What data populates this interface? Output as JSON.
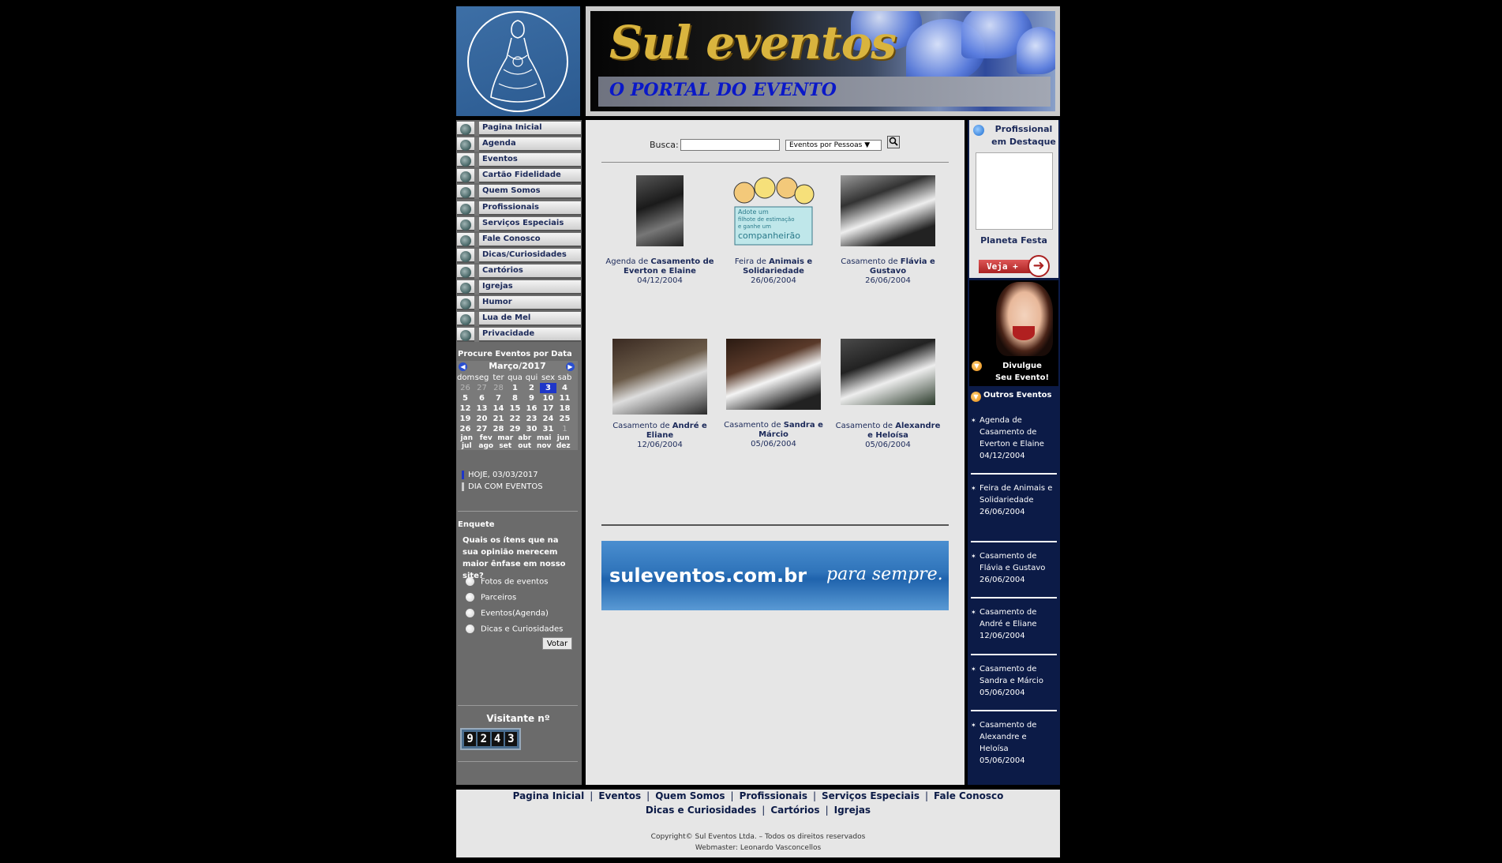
{
  "header": {
    "title": "Sul eventos",
    "subtitle": "O PORTAL DO EVENTO"
  },
  "menu": [
    "Pagina Inicial",
    "Agenda",
    "Eventos",
    "Cartão Fidelidade",
    "Quem Somos",
    "Profissionais",
    "Serviços Especiais",
    "Fale Conosco",
    "Dicas/Curiosidades",
    "Cartórios",
    "Igrejas",
    "Humor",
    "Lua de Mel",
    "Privacidade"
  ],
  "calendar": {
    "heading": "Procure Eventos por Data",
    "month": "Março/2017",
    "prev": "◀",
    "next": "▶",
    "dow": [
      "dom",
      "seg",
      "ter",
      "qua",
      "qui",
      "sex",
      "sab"
    ],
    "rows": [
      [
        "26",
        "27",
        "28",
        "1",
        "2",
        "3",
        "4"
      ],
      [
        "5",
        "6",
        "7",
        "8",
        "9",
        "10",
        "11"
      ],
      [
        "12",
        "13",
        "14",
        "15",
        "16",
        "17",
        "18"
      ],
      [
        "19",
        "20",
        "21",
        "22",
        "23",
        "24",
        "25"
      ],
      [
        "26",
        "27",
        "28",
        "29",
        "30",
        "31",
        "1"
      ]
    ],
    "months_top": [
      "jan",
      "fev",
      "mar",
      "abr",
      "mai",
      "jun"
    ],
    "months_bottom": [
      "jul",
      "ago",
      "set",
      "out",
      "nov",
      "dez"
    ],
    "today_legend": "HOJE, 03/03/2017",
    "event_legend": "DIA COM EVENTOS",
    "today_color": "#1e36c8"
  },
  "poll": {
    "title": "Enquete",
    "question": "Quais os ítens que na sua opinião merecem maior ênfase em nosso site?",
    "options": [
      "Fotos de eventos",
      "Parceiros",
      "Eventos(Agenda)",
      "Dicas e Curiosidades"
    ],
    "vote": "Votar"
  },
  "visitor": {
    "label": "Visitante nº",
    "digits": [
      "9",
      "2",
      "4",
      "3"
    ]
  },
  "search": {
    "label": "Busca:",
    "value": "",
    "select_value": "Eventos por Pessoas ▼",
    "button_icon": "search-icon"
  },
  "events_grid": [
    {
      "pre": "Agenda de ",
      "name": "Casamento de Everton e Elaine",
      "date": "04/12/2004"
    },
    {
      "pre": "Feira de ",
      "name": "Animais e Solidariedade",
      "date": "26/06/2004",
      "image_text": [
        "Adote um",
        "filhote de estimação",
        "e ganhe um",
        "companheirão"
      ]
    },
    {
      "pre": "Casamento de ",
      "name": "Flávia e Gustavo",
      "date": "26/06/2004"
    },
    {
      "pre": "Casamento de ",
      "name": "André e Eliane",
      "date": "12/06/2004"
    },
    {
      "pre": "Casamento de ",
      "name": "Sandra e Márcio",
      "date": "05/06/2004"
    },
    {
      "pre": "Casamento de ",
      "name": "Alexandre e Heloísa",
      "date": "05/06/2004"
    }
  ],
  "ad": {
    "domain": "suleventos.com.br",
    "slogan": "para sempre."
  },
  "right": {
    "prof_title": "Profissional em Destaque",
    "prof_name": "Planeta Festa",
    "veja": "Veja +",
    "divulgue": "Divulgue Seu Evento!",
    "outros_title": "Outros Eventos",
    "outros": [
      "Agenda de Casamento de Everton e Elaine 04/12/2004",
      "Feira de Animais e Solidariedade 26/06/2004",
      "Casamento de Flávia e Gustavo 26/06/2004",
      "Casamento de André e Eliane 12/06/2004",
      "Casamento de Sandra e Márcio 05/06/2004",
      "Casamento de Alexandre e Heloísa 05/06/2004"
    ]
  },
  "footer": {
    "links_row1": [
      "Pagina Inicial",
      "Eventos",
      "Quem Somos",
      "Profissionais",
      "Serviços Especiais",
      "Fale Conosco"
    ],
    "links_row2": [
      "Dicas e Curiosidades",
      "Cartórios",
      "Igrejas"
    ],
    "separator": "|",
    "copyright": "Copyright© Sul Eventos Ltda. – Todos os direitos reservados",
    "webmaster": "Webmaster: Leonardo Vasconcellos"
  },
  "colors": {
    "background": "#000000",
    "panel": "#e6e6e6",
    "left_panel": "#6b6b6b",
    "right_panel": "#0c1b47",
    "link": "#1c2a5a",
    "brand_gold": "#d9b43e",
    "brand_blue": "#0a18c8"
  }
}
